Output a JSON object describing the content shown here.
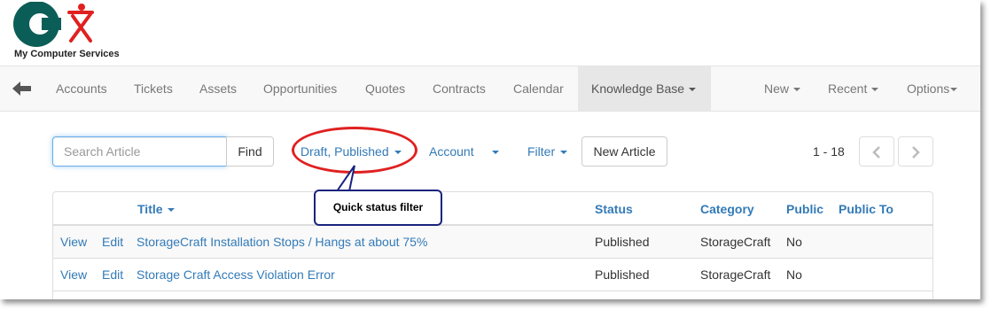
{
  "app": {
    "company_name": "My Computer Services",
    "colors": {
      "logo_teal": "#0b5e57",
      "logo_red": "#e02020",
      "link": "#337ab7"
    }
  },
  "navbar": {
    "back_icon": "arrow-left-icon",
    "items": [
      {
        "label": "Accounts"
      },
      {
        "label": "Tickets"
      },
      {
        "label": "Assets"
      },
      {
        "label": "Opportunities"
      },
      {
        "label": "Quotes"
      },
      {
        "label": "Contracts"
      },
      {
        "label": "Calendar"
      },
      {
        "label": "Knowledge Base",
        "active": true
      }
    ],
    "right_items": [
      {
        "label": "New"
      },
      {
        "label": "Recent"
      },
      {
        "label": "Options"
      }
    ]
  },
  "toolbar": {
    "search_placeholder": "Search Article",
    "find_label": "Find",
    "status_filter_label": "Draft, Published",
    "account_label": "Account",
    "filter_label": "Filter",
    "new_article_label": "New Article",
    "pager_range": "1 - 18"
  },
  "annotation": {
    "callout_text": "Quick status filter"
  },
  "table": {
    "columns": [
      "Title",
      "Status",
      "Category",
      "Public",
      "Public To"
    ],
    "rows": [
      {
        "view": "View",
        "edit": "Edit",
        "title": "StorageCraft Installation Stops / Hangs at about 75%",
        "status": "Published",
        "category": "StorageCraft",
        "public": "No",
        "public_to": ""
      },
      {
        "view": "View",
        "edit": "Edit",
        "title": "Storage Craft Access Violation Error",
        "status": "Published",
        "category": "StorageCraft",
        "public": "No",
        "public_to": ""
      }
    ]
  }
}
